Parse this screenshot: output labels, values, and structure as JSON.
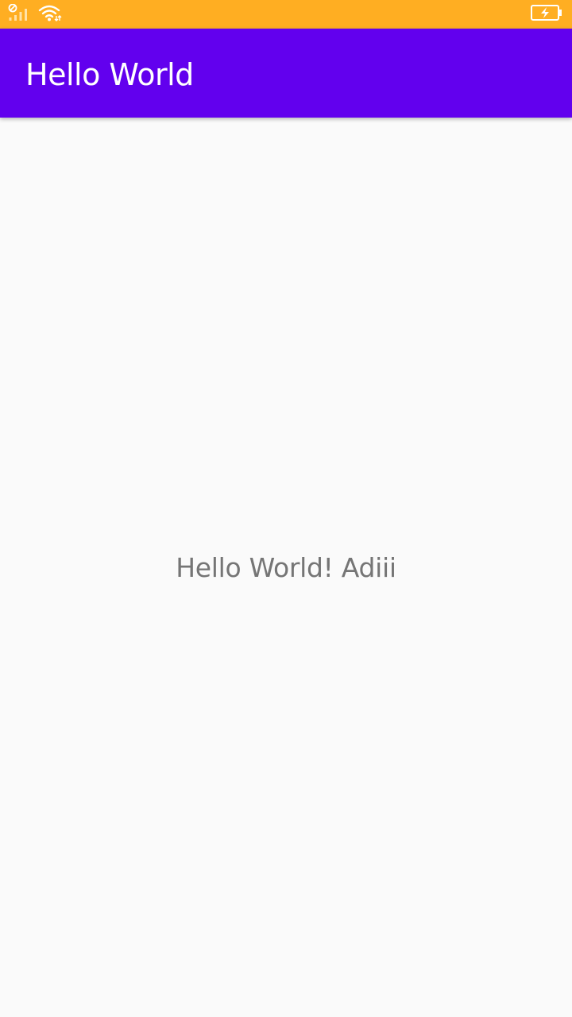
{
  "status_bar": {
    "background": "#ffae22",
    "icons": [
      "sim-signal-icon",
      "wifi-icon",
      "battery-charging-icon"
    ]
  },
  "app_bar": {
    "title": "Hello World",
    "background": "#6200ee"
  },
  "main": {
    "message": "Hello World! Adiii"
  }
}
